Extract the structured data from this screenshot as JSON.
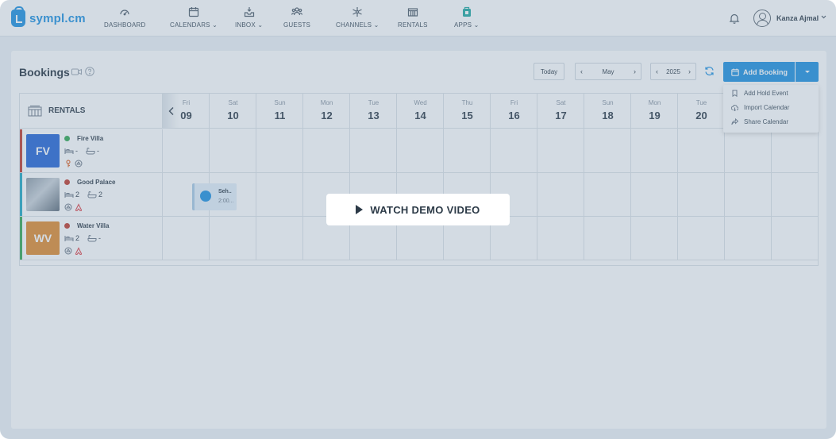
{
  "brand": {
    "name": "sympl.cm",
    "color": "#1b8fe0"
  },
  "nav": [
    {
      "label": "DASHBOARD",
      "icon": "gauge-icon",
      "dropdown": false
    },
    {
      "label": "CALENDARS",
      "icon": "calendar-icon",
      "dropdown": true
    },
    {
      "label": "INBOX",
      "icon": "inbox-icon",
      "dropdown": true
    },
    {
      "label": "GUESTS",
      "icon": "guests-icon",
      "dropdown": false
    },
    {
      "label": "CHANNELS",
      "icon": "channels-icon",
      "dropdown": true
    },
    {
      "label": "RENTALS",
      "icon": "rentals-icon",
      "dropdown": false
    },
    {
      "label": "APPS",
      "icon": "apps-icon",
      "dropdown": true
    }
  ],
  "user": {
    "name": "Kanza Ajmal"
  },
  "page": {
    "title": "Bookings"
  },
  "controls": {
    "today": "Today",
    "month": "May",
    "year": "2025",
    "add_booking": "Add Booking"
  },
  "add_menu": [
    {
      "label": "Add Hold Event",
      "icon": "bookmark-icon"
    },
    {
      "label": "Import Calendar",
      "icon": "cloud-download-icon"
    },
    {
      "label": "Share Calendar",
      "icon": "share-icon"
    }
  ],
  "calendar": {
    "rentals_header": "RENTALS",
    "days": [
      {
        "name": "Fri",
        "num": "09"
      },
      {
        "name": "Sat",
        "num": "10"
      },
      {
        "name": "Sun",
        "num": "11"
      },
      {
        "name": "Mon",
        "num": "12"
      },
      {
        "name": "Tue",
        "num": "13"
      },
      {
        "name": "Wed",
        "num": "14"
      },
      {
        "name": "Thu",
        "num": "15"
      },
      {
        "name": "Fri",
        "num": "16"
      },
      {
        "name": "Sat",
        "num": "17"
      },
      {
        "name": "Sun",
        "num": "18"
      },
      {
        "name": "Mon",
        "num": "19"
      },
      {
        "name": "Tue",
        "num": "20"
      },
      {
        "name": "",
        "num": ""
      },
      {
        "name": "",
        "num": ""
      }
    ]
  },
  "rentals": [
    {
      "initials": "FV",
      "name": "Fire Villa",
      "status_color": "#2fa84f",
      "bar_color": "#c0392b",
      "thumb_color": "#2263d6",
      "beds": "-",
      "baths": "-",
      "channels": [
        "key-icon",
        "booking-sync-icon"
      ]
    },
    {
      "initials": "",
      "name": "Good Palace",
      "status_color": "#c0392b",
      "bar_color": "#1fa7c4",
      "thumb_color": "#6d7d8c",
      "beds": "2",
      "baths": "2",
      "channels": [
        "booking-sync-icon",
        "airbnb-icon"
      ]
    },
    {
      "initials": "WV",
      "name": "Water Villa",
      "status_color": "#c0392b",
      "bar_color": "#34a853",
      "thumb_color": "#e08a2c",
      "beds": "2",
      "baths": "-",
      "channels": [
        "booking-sync-icon",
        "airbnb-icon"
      ]
    }
  ],
  "booking": {
    "title": "Seh..",
    "subtitle": "2:00..."
  },
  "overlay": {
    "demo_label": "WATCH DEMO VIDEO"
  }
}
